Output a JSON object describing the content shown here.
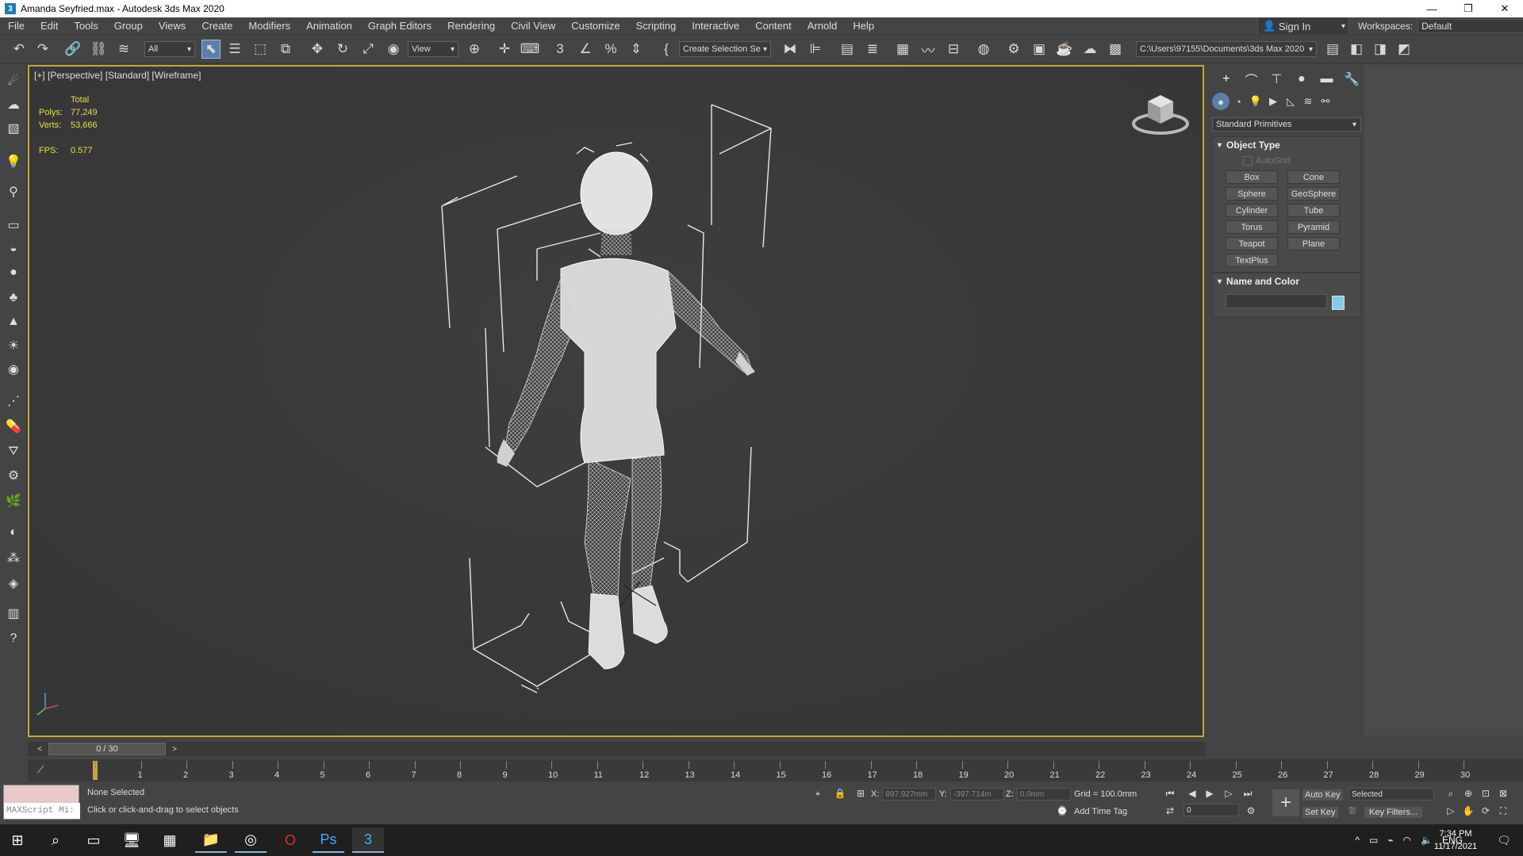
{
  "window": {
    "title": "Amanda Seyfried.max - Autodesk 3ds Max 2020",
    "app_icon": "3"
  },
  "menu": [
    "File",
    "Edit",
    "Tools",
    "Group",
    "Views",
    "Create",
    "Modifiers",
    "Animation",
    "Graph Editors",
    "Rendering",
    "Civil View",
    "Customize",
    "Scripting",
    "Interactive",
    "Content",
    "Arnold",
    "Help"
  ],
  "header": {
    "sign_in": "Sign In",
    "workspaces_label": "Workspaces:",
    "workspace_value": "Default"
  },
  "toolbar": {
    "filter_value": "All",
    "ref_coord_value": "View",
    "selection_set": "Create Selection Se",
    "project_path": "C:\\Users\\97155\\Documents\\3ds Max 2020"
  },
  "viewport": {
    "label": "[+] [Perspective] [Standard] [Wireframe]",
    "stats_total": "Total",
    "polys_label": "Polys:",
    "polys_value": "77,249",
    "verts_label": "Verts:",
    "verts_value": "53,666",
    "fps_label": "FPS:",
    "fps_value": "0.577"
  },
  "command_panel": {
    "category": "Standard Primitives",
    "object_type_title": "Object Type",
    "autogrid": "AutoGrid",
    "buttons": [
      "Box",
      "Cone",
      "Sphere",
      "GeoSphere",
      "Cylinder",
      "Tube",
      "Torus",
      "Pyramid",
      "Teapot",
      "Plane",
      "TextPlus"
    ],
    "name_color_title": "Name and Color",
    "swatch_color": "#86c9e6"
  },
  "timeline": {
    "slider": "0 / 30",
    "ticks": [
      "0",
      "1",
      "2",
      "3",
      "4",
      "5",
      "6",
      "7",
      "8",
      "9",
      "10",
      "11",
      "12",
      "13",
      "14",
      "15",
      "16",
      "17",
      "18",
      "19",
      "20",
      "21",
      "22",
      "23",
      "24",
      "25",
      "26",
      "27",
      "28",
      "29",
      "30"
    ]
  },
  "status": {
    "maxscript": "MAXScript Mi:",
    "selection": "None Selected",
    "prompt": "Click or click-and-drag to select objects",
    "x_label": "X:",
    "x_value": "897.927mm",
    "y_label": "Y:",
    "y_value": "-397.714m",
    "z_label": "Z:",
    "z_value": "0.0mm",
    "grid": "Grid = 100.0mm",
    "add_time_tag": "Add Time Tag",
    "auto_key": "Auto Key",
    "set_key": "Set Key",
    "key_mode": "Selected",
    "key_filters": "Key Filters...",
    "frame_value": "0"
  },
  "taskbar": {
    "lang": "ENG",
    "time": "7:34 PM",
    "date": "11/17/2021"
  }
}
